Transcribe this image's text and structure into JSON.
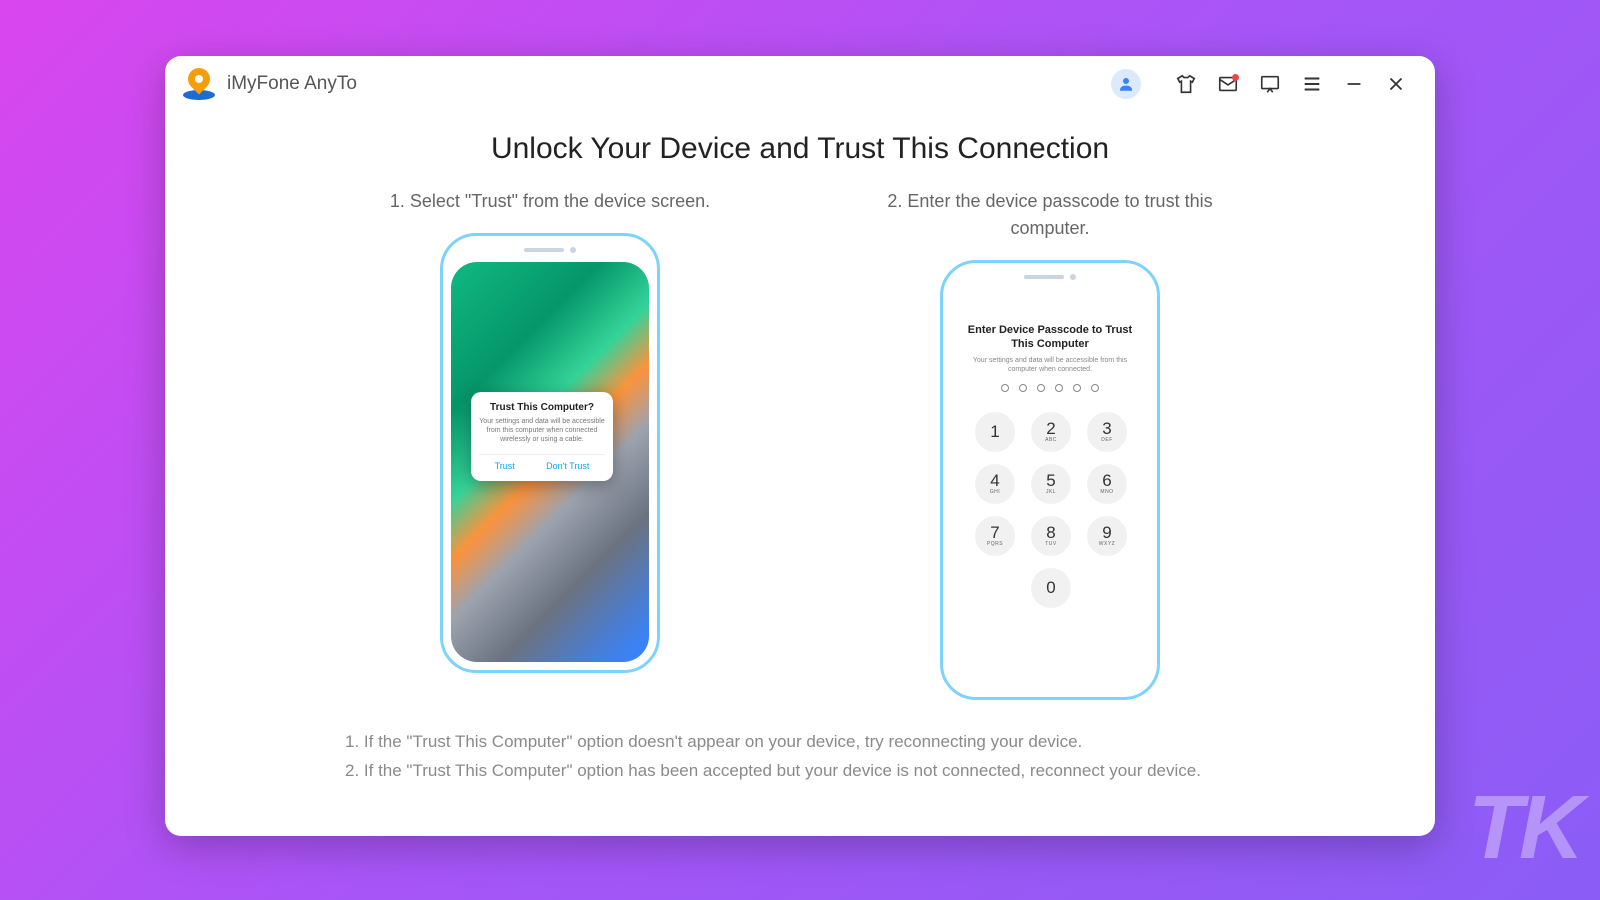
{
  "app": {
    "title": "iMyFone AnyTo"
  },
  "heading": "Unlock Your Device and Trust This Connection",
  "steps": {
    "one": {
      "label": "1. Select \"Trust\" from the device screen."
    },
    "two": {
      "label": "2. Enter the device passcode to trust this computer."
    }
  },
  "alert": {
    "title": "Trust This Computer?",
    "body": "Your settings and data will be accessible from this computer when connected wirelessly or using a cable.",
    "trust": "Trust",
    "dont": "Don't Trust"
  },
  "passcode": {
    "title": "Enter Device Passcode to Trust This Computer",
    "subtitle": "Your settings and data will be accessible from this computer when connected."
  },
  "keypad": {
    "k1": "1",
    "k2": "2",
    "k3": "3",
    "k4": "4",
    "k5": "5",
    "k6": "6",
    "k7": "7",
    "k8": "8",
    "k9": "9",
    "k0": "0",
    "s2": "ABC",
    "s3": "DEF",
    "s4": "GHI",
    "s5": "JKL",
    "s6": "MNO",
    "s7": "PQRS",
    "s8": "TUV",
    "s9": "WXYZ"
  },
  "notes": {
    "n1": "1. If the \"Trust This Computer\" option doesn't appear on your device, try reconnecting your device.",
    "n2": "2. If the \"Trust This Computer\" option has been accepted but your device is not connected, reconnect your device."
  },
  "watermark": "TK"
}
